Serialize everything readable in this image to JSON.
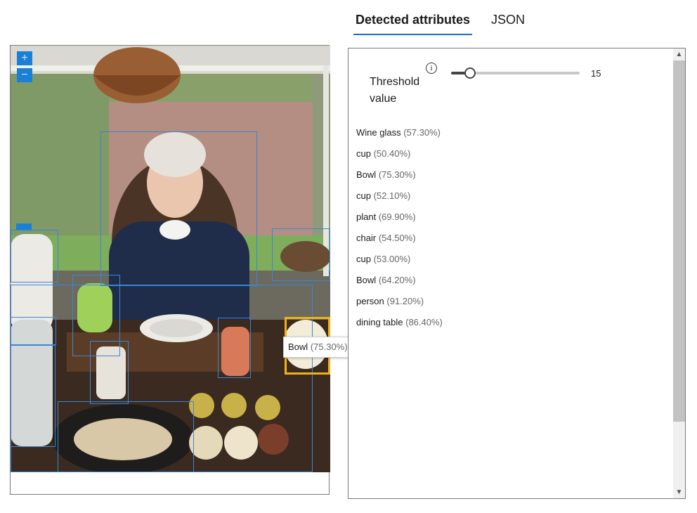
{
  "tabs": [
    {
      "label": "Detected attributes",
      "active": true
    },
    {
      "label": "JSON",
      "active": false
    }
  ],
  "viewer": {
    "zoom_in_icon": "plus-icon",
    "zoom_out_icon": "minus-icon",
    "tooltip": {
      "name": "Bowl",
      "confidence": "(75.30%)"
    }
  },
  "threshold": {
    "label": "Threshold value",
    "value": "15",
    "fraction": 0.15,
    "info_icon": "info-icon"
  },
  "attributes": [
    {
      "name": "Wine glass",
      "confidence": "(57.30%)"
    },
    {
      "name": "cup",
      "confidence": "(50.40%)"
    },
    {
      "name": "Bowl",
      "confidence": "(75.30%)"
    },
    {
      "name": "cup",
      "confidence": "(52.10%)"
    },
    {
      "name": "plant",
      "confidence": "(69.90%)"
    },
    {
      "name": "chair",
      "confidence": "(54.50%)"
    },
    {
      "name": "cup",
      "confidence": "(53.00%)"
    },
    {
      "name": "Bowl",
      "confidence": "(64.20%)"
    },
    {
      "name": "person",
      "confidence": "(91.20%)"
    },
    {
      "name": "dining table",
      "confidence": "(86.40%)"
    }
  ],
  "colors": {
    "accent": "#1a6fc4",
    "bbox": "#3a86d6",
    "selected_bbox": "#f2b311"
  }
}
